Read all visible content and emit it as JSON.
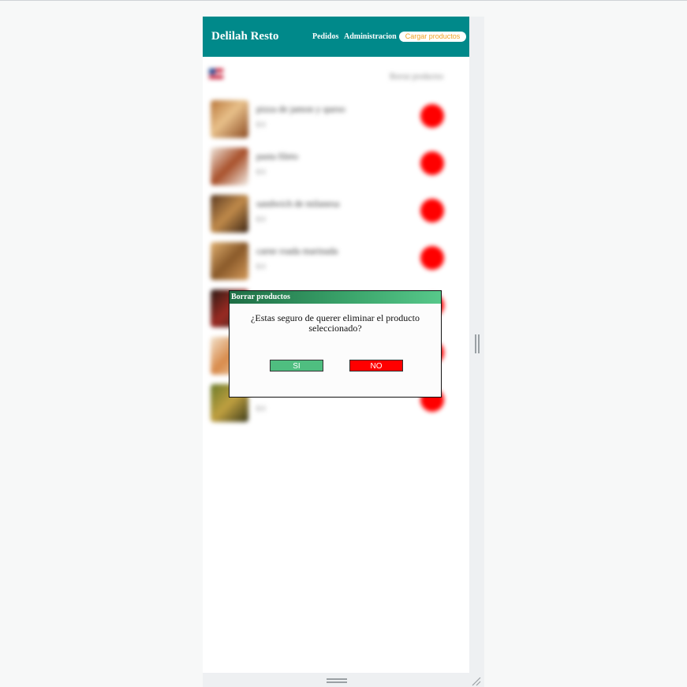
{
  "header": {
    "brand": "Delilah Resto",
    "nav": {
      "pedidos": "Pedidos",
      "admin": "Administracion",
      "cargar": "Cargar productos"
    }
  },
  "content": {
    "flag_icon": "uk-flag-icon",
    "list_title": "Borrar productos",
    "products": [
      {
        "name": "pizza de jamon y queso",
        "price": "$ 0"
      },
      {
        "name": "pasta fileto",
        "price": "$ 0"
      },
      {
        "name": "sandwich de milanesa",
        "price": "$ 0"
      },
      {
        "name": "carne roada marinada",
        "price": "$ 0"
      },
      {
        "name": "",
        "price": ""
      },
      {
        "name": "",
        "price": ""
      },
      {
        "name": "",
        "price": "$ 0"
      }
    ]
  },
  "modal": {
    "title": "Borrar productos",
    "message": "¿Estas seguro de querer eliminar el producto seleccionado?",
    "yes_label": "SI",
    "no_label": "NO"
  },
  "colors": {
    "header": "#00898a",
    "accent": "#f2a020",
    "delete": "#ff0000",
    "confirm": "#4fbe80"
  }
}
